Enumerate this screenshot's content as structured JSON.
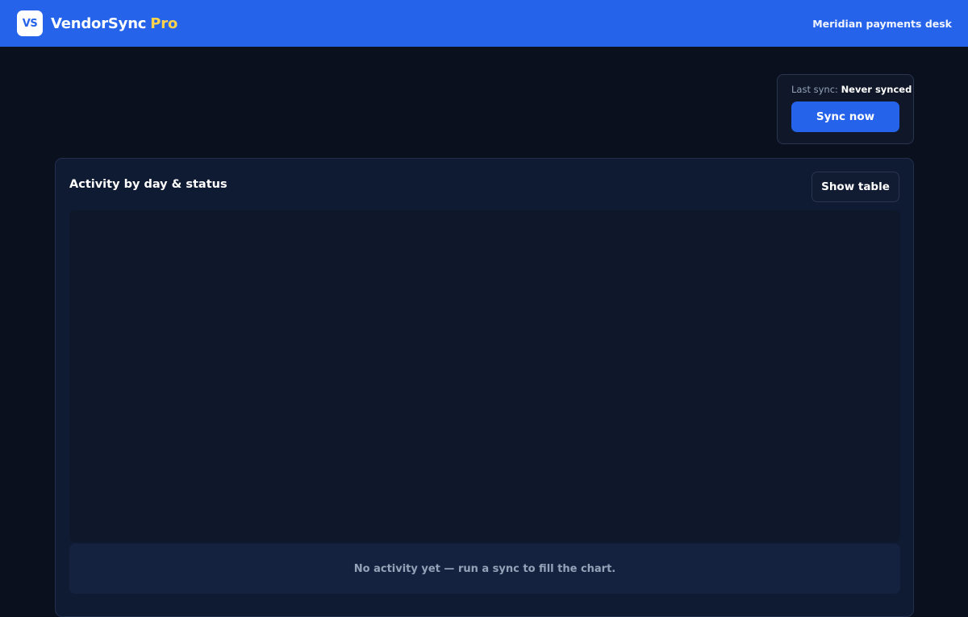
{
  "header": {
    "logo_text": "VS",
    "brand_name": "VendorSync",
    "brand_tier": "Pro",
    "workspace": "Meridian payments desk"
  },
  "sync": {
    "status_label": "Last sync:",
    "status_value": "Never synced",
    "button_label": "Sync now"
  },
  "activity": {
    "title": "Activity by day & status",
    "toggle_label": "Show table",
    "empty_message": "No activity yet — run a sync to fill the chart."
  },
  "colors": {
    "brand_blue": "#2563eb",
    "tier_yellow": "#fcd34d",
    "page_background": "#0a101e",
    "panel_background": "#0f1a33",
    "muted_text": "#94a3b8"
  }
}
